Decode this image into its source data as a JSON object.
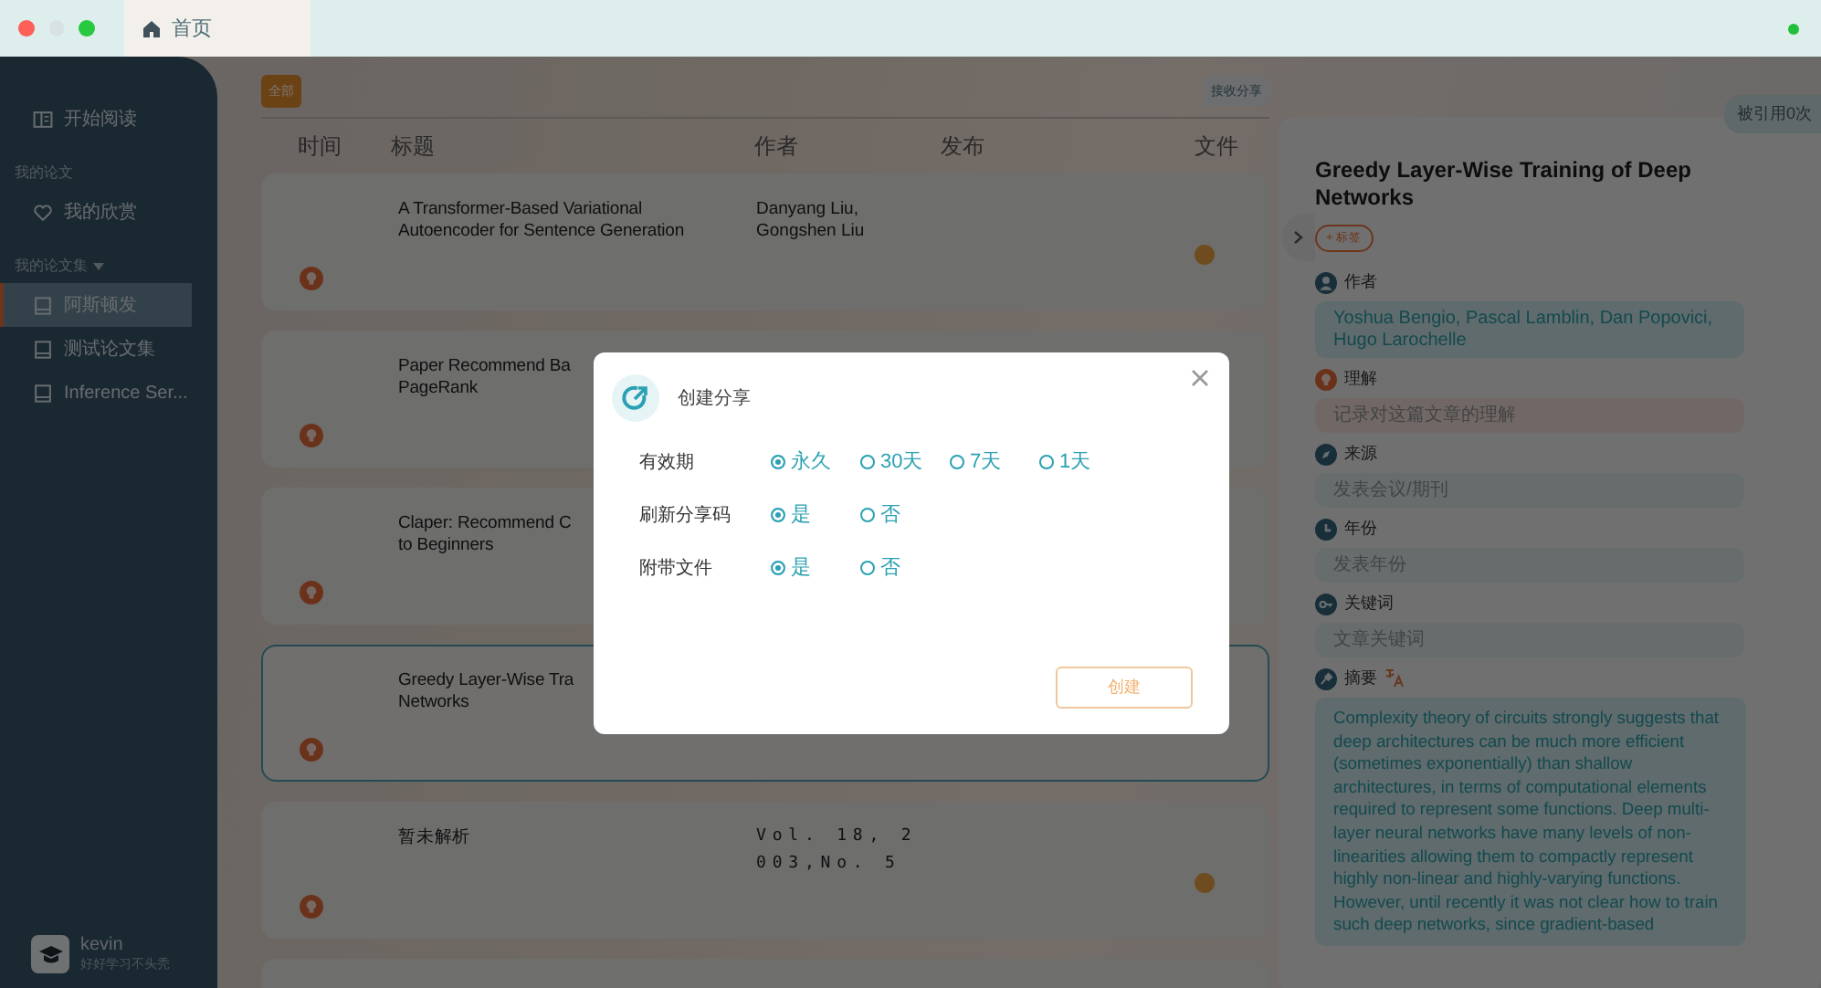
{
  "tabs": [
    {
      "label": "首页",
      "selected": true
    }
  ],
  "sidebar": {
    "sections": [
      {
        "items": [
          {
            "kind": "reading",
            "label": "开始阅读",
            "selected": false
          }
        ]
      },
      {
        "heading": "我的论文",
        "items": [
          {
            "kind": "favorites",
            "label": "我的欣赏",
            "selected": false
          }
        ]
      },
      {
        "heading": "我的论文集",
        "expanded": true,
        "items": [
          {
            "kind": "collection",
            "label": "阿斯顿发",
            "selected": true
          },
          {
            "kind": "collection",
            "label": "测试论文集",
            "selected": false
          },
          {
            "kind": "collection",
            "label": "Inference Ser...",
            "selected": false
          }
        ]
      }
    ]
  },
  "user": {
    "name": "kevin",
    "motto": "好好学习不头秃"
  },
  "filter": {
    "label": "全部",
    "selected": true
  },
  "receive_button": "接收分享",
  "columns": [
    "时间",
    "标题",
    "作者",
    "发布",
    "文件"
  ],
  "rows": [
    {
      "title_lines": [
        "A Transformer-Based Variational",
        "Autoencoder for Sentence Generation"
      ],
      "author_lines": [
        "Danyang Liu,",
        "Gongshen Liu"
      ],
      "has_file": true,
      "selected": false
    },
    {
      "title_lines": [
        "Paper Recommend Ba",
        "PageRank"
      ],
      "author_lines": [],
      "has_file": false,
      "selected": false
    },
    {
      "title_lines": [
        "Claper: Recommend C",
        "to Beginners"
      ],
      "author_lines": [],
      "has_file": false,
      "selected": false
    },
    {
      "title_lines": [
        "Greedy Layer-Wise Tra",
        "Networks"
      ],
      "author_lines": [],
      "has_file": false,
      "selected": true
    },
    {
      "title_lines": [
        "暂未解析"
      ],
      "author_lines": [
        "Vol. 18, 2",
        "003,No. 5"
      ],
      "spaced": true,
      "has_file": true,
      "selected": false
    },
    {
      "selected": false
    }
  ],
  "detail": {
    "citations": "被引用0次",
    "title": "Greedy Layer-Wise Training of Deep Networks",
    "tag_button": "+ 标签",
    "fields": [
      {
        "kind": "author",
        "label": "作者",
        "value": "Yoshua Bengio, Pascal Lamblin, Dan Popovici, Hugo Larochelle"
      },
      {
        "kind": "understanding",
        "label": "理解",
        "placeholder": "记录对这篇文章的理解"
      },
      {
        "kind": "source",
        "label": "来源",
        "placeholder": "发表会议/期刊"
      },
      {
        "kind": "year",
        "label": "年份",
        "placeholder": "发表年份"
      },
      {
        "kind": "keywords",
        "label": "关键词",
        "placeholder": "文章关键词"
      },
      {
        "kind": "abstract",
        "label": "摘要",
        "translatable": true,
        "value": "Complexity theory of circuits strongly suggests that deep architectures can be much more efficient (sometimes exponentially) than shallow architectures, in terms of computational elements required to represent some functions. Deep multi-layer neural networks have many levels of non-linearities allowing them to compactly represent highly non-linear and highly-varying functions. However, until recently it was not clear how to train such deep networks, since gradient-based"
      }
    ]
  },
  "dialog": {
    "title": "创建分享",
    "options": [
      {
        "label": "有效期",
        "choices": [
          {
            "label": "永久",
            "selected": true
          },
          {
            "label": "30天",
            "selected": false
          },
          {
            "label": "7天",
            "selected": false
          },
          {
            "label": "1天",
            "selected": false
          }
        ]
      },
      {
        "label": "刷新分享码",
        "choices": [
          {
            "label": "是",
            "selected": true
          },
          {
            "label": "否",
            "selected": false
          }
        ]
      },
      {
        "label": "附带文件",
        "choices": [
          {
            "label": "是",
            "selected": true
          },
          {
            "label": "否",
            "selected": false
          }
        ]
      }
    ],
    "create_button": "创建"
  }
}
